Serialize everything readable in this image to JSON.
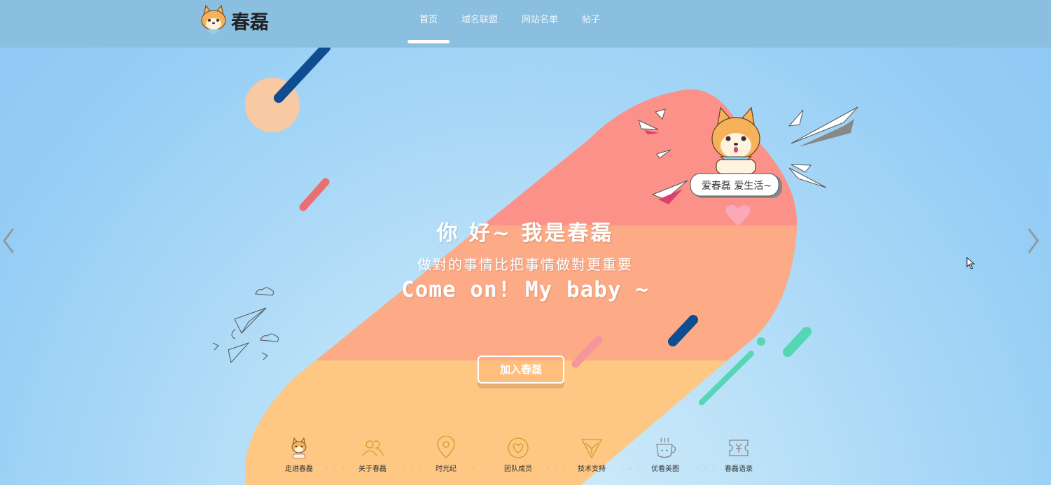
{
  "header": {
    "logo_text": "春磊",
    "nav": [
      {
        "label": "首页",
        "active": true
      },
      {
        "label": "域名联盟",
        "active": false
      },
      {
        "label": "网站名单",
        "active": false
      },
      {
        "label": "帖子",
        "active": false
      }
    ]
  },
  "hero": {
    "line1": "你 好~ 我是春磊",
    "line2": "做對的事情比把事情做對更重要",
    "line3": "Come on! My baby ~",
    "join_button": "加入春磊",
    "speech_bubble": "爱春磊 爱生活~"
  },
  "bottom_nav": [
    {
      "label": "走进春磊",
      "icon": "dog-mascot-icon"
    },
    {
      "label": "关于春磊",
      "icon": "people-icon"
    },
    {
      "label": "时光纪",
      "icon": "location-pin-icon"
    },
    {
      "label": "团队成员",
      "icon": "heart-icon"
    },
    {
      "label": "技术支持",
      "icon": "triangle-icon"
    },
    {
      "label": "优看美图",
      "icon": "coffee-cup-icon"
    },
    {
      "label": "春磊语录",
      "icon": "ticket-icon"
    }
  ],
  "colors": {
    "header_bg": "#8bbfe0",
    "band_pink": "#fb9189",
    "band_salmon": "#fdaa86",
    "band_peach": "#fec783",
    "accent_gold": "#c9a227",
    "bottom_label_color": "#333333"
  }
}
